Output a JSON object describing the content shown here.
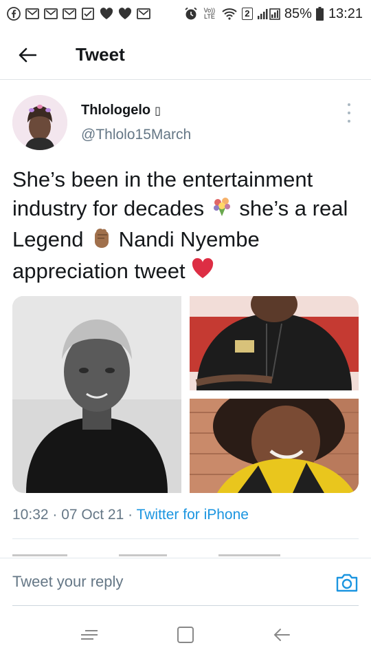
{
  "status_bar": {
    "battery": "85%",
    "time": "13:21",
    "volte": "Vo)) LTE",
    "sim_slot": "2",
    "left_icons": [
      "facebook-icon",
      "gmail-icon",
      "gmail-icon",
      "gmail-icon",
      "checkbox-icon",
      "heart-icon",
      "heart-icon",
      "gmail-icon"
    ]
  },
  "header": {
    "title": "Tweet",
    "back_icon": "arrow-left-icon"
  },
  "tweet": {
    "author_name": "Thlologelo",
    "author_name_suffix": "▯",
    "author_handle": "@Thlolo15March",
    "text_part1": "She’s been in the entertainment industry for decades ",
    "text_part2": " she’s a real Legend ",
    "text_part3": " Nandi Nyembe appreciation tweet ",
    "timestamp": "10:32 · 07 Oct 21 · ",
    "source": "Twitter for iPhone"
  },
  "reply": {
    "placeholder": "Tweet your reply"
  },
  "colors": {
    "accent": "#1b95e0",
    "text": "#14171a",
    "secondary": "#657786",
    "divider": "#e1e8ed"
  }
}
